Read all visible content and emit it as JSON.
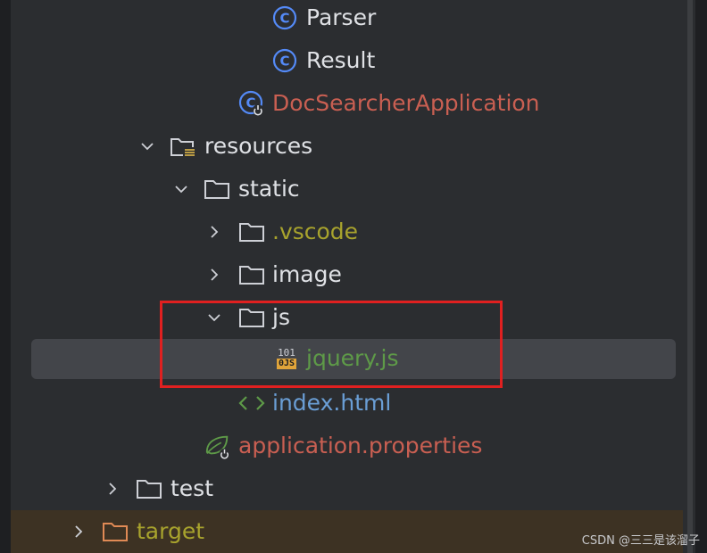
{
  "tree": {
    "items": [
      {
        "label": "Parser",
        "icon": "class-icon",
        "color": "#dfe1e5"
      },
      {
        "label": "Result",
        "icon": "class-icon",
        "color": "#dfe1e5"
      },
      {
        "label": "DocSearcherApplication",
        "icon": "spring-boot-class-icon",
        "color": "#c95f52"
      },
      {
        "label": "resources",
        "icon": "resources-folder-icon",
        "expanded": true
      },
      {
        "label": "static",
        "icon": "folder-icon",
        "expanded": true
      },
      {
        "label": ".vscode",
        "icon": "folder-icon",
        "expanded": false,
        "color": "#a8a32d"
      },
      {
        "label": "image",
        "icon": "folder-icon",
        "expanded": false
      },
      {
        "label": "js",
        "icon": "folder-icon",
        "expanded": true
      },
      {
        "label": "jquery.js",
        "icon": "javascript-file-icon",
        "selected": true,
        "color": "#5e9a48",
        "icon_text_top": "101",
        "icon_text_badge": "0JS"
      },
      {
        "label": "index.html",
        "icon": "html-file-icon",
        "color": "#6a9ed5"
      },
      {
        "label": "application.properties",
        "icon": "spring-properties-icon",
        "color": "#c95f52"
      },
      {
        "label": "test",
        "icon": "folder-icon",
        "expanded": false
      },
      {
        "label": "target",
        "icon": "excluded-folder-icon",
        "expanded": false,
        "color": "#a8a32d"
      }
    ]
  },
  "watermark": "CSDN @三三是该溜子",
  "colors": {
    "background": "#2b2d30",
    "selection": "#43454a",
    "highlight_box": "#e02020"
  }
}
